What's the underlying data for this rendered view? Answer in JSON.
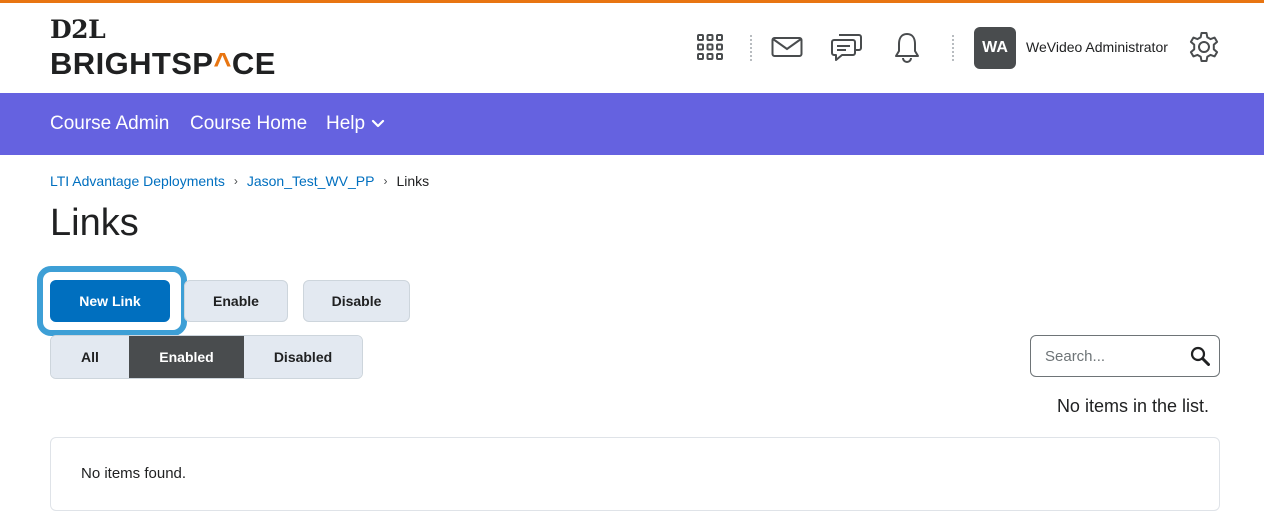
{
  "brand": {
    "logo_top": "D2L",
    "logo_bottom_prefix": "BRIGHTSP",
    "logo_bottom_accent": "^",
    "logo_bottom_suffix": "CE",
    "accent_color": "#e87511",
    "nav_color": "#6562e0",
    "primary_color": "#006fbf"
  },
  "header": {
    "icons": [
      "waffle-icon",
      "mail-icon",
      "chat-icon",
      "bell-icon",
      "gear-icon"
    ],
    "avatar_initials": "WA",
    "user_name": "WeVideo Administrator"
  },
  "nav": {
    "items": [
      {
        "label": "Course Admin"
      },
      {
        "label": "Course Home"
      },
      {
        "label": "Help"
      }
    ]
  },
  "breadcrumb": {
    "items": [
      "LTI Advantage Deployments",
      "Jason_Test_WV_PP"
    ],
    "current": "Links"
  },
  "page": {
    "title": "Links"
  },
  "actions": {
    "new_link": "New Link",
    "enable": "Enable",
    "disable": "Disable"
  },
  "filter": {
    "options": [
      "All",
      "Enabled",
      "Disabled"
    ],
    "selected": "Enabled"
  },
  "search": {
    "placeholder": "Search..."
  },
  "list": {
    "status": "No items in the list.",
    "empty_message": "No items found."
  }
}
